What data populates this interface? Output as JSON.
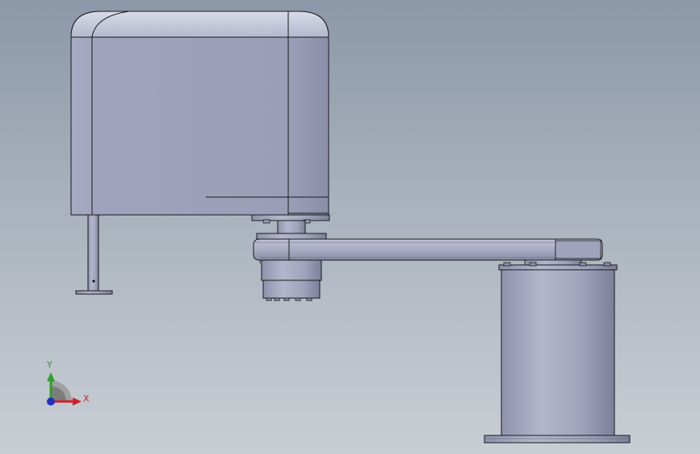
{
  "viewport": {
    "background_top": "#8c98a8",
    "background_bottom": "#c9ced4",
    "model_color": "#a2a6be",
    "edge_color": "#1a1a1a"
  },
  "triad": {
    "x_label": "X",
    "y_label": "Y",
    "x_color": "#d0202a",
    "y_color": "#2aa02a",
    "z_color": "#2030c0",
    "icons": [
      "axis-triad-icon"
    ]
  },
  "model_parts": [
    "head-housing",
    "quill-shaft",
    "tool-flange",
    "elbow-joint",
    "arm-link",
    "base-column",
    "base-plate"
  ]
}
